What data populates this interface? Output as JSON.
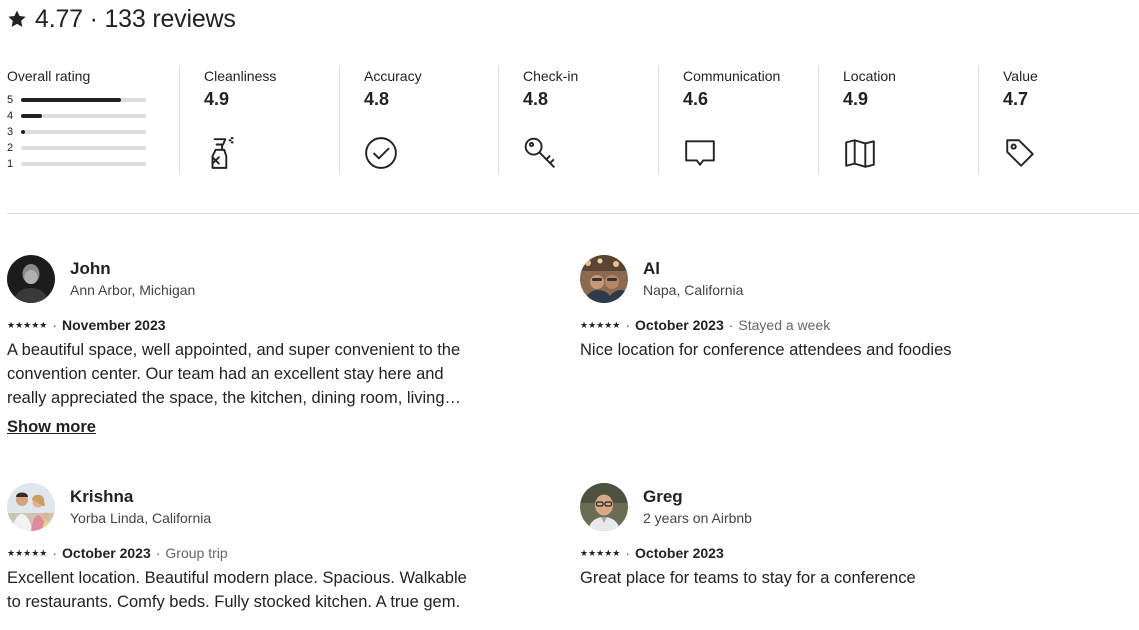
{
  "header": {
    "title": "4.77 · 133 reviews",
    "icon": "star-icon"
  },
  "summary": {
    "overall_label": "Overall rating",
    "distribution": [
      {
        "stars": "5",
        "fraction": 0.8
      },
      {
        "stars": "4",
        "fraction": 0.17
      },
      {
        "stars": "3",
        "fraction": 0.03
      },
      {
        "stars": "2",
        "fraction": 0.0
      },
      {
        "stars": "1",
        "fraction": 0.0
      }
    ],
    "categories": [
      {
        "label": "Cleanliness",
        "value": "4.9",
        "icon": "spray-bottle-icon"
      },
      {
        "label": "Accuracy",
        "value": "4.8",
        "icon": "check-circle-icon"
      },
      {
        "label": "Check-in",
        "value": "4.8",
        "icon": "key-icon"
      },
      {
        "label": "Communication",
        "value": "4.6",
        "icon": "message-icon"
      },
      {
        "label": "Location",
        "value": "4.9",
        "icon": "map-icon"
      },
      {
        "label": "Value",
        "value": "4.7",
        "icon": "tag-icon"
      }
    ]
  },
  "reviews": [
    {
      "name": "John",
      "location": "Ann Arbor, Michigan",
      "stars": "★★★★★",
      "date": "November 2023",
      "extra": "",
      "text": "A beautiful space, well appointed, and super convenient to the convention center. Our team had an excellent stay here and really appreciated the space, the kitchen, dining room, living…",
      "show_more": "Show more"
    },
    {
      "name": "Al",
      "location": "Napa, California",
      "stars": "★★★★★",
      "date": "October 2023",
      "extra": "Stayed a week",
      "text": "Nice location for conference attendees and foodies"
    },
    {
      "name": "Krishna",
      "location": "Yorba Linda, California",
      "stars": "★★★★★",
      "date": "October 2023",
      "extra": "Group trip",
      "text": "Excellent location. Beautiful modern place. Spacious. Walkable to restaurants. Comfy beds. Fully stocked kitchen. A true gem."
    },
    {
      "name": "Greg",
      "location": "2 years on Airbnb",
      "stars": "★★★★★",
      "date": "October 2023",
      "extra": "",
      "text": "Great place for teams to stay for a conference"
    }
  ],
  "colors": {
    "text": "#222222",
    "muted": "#666666",
    "divider": "#dddddd"
  }
}
